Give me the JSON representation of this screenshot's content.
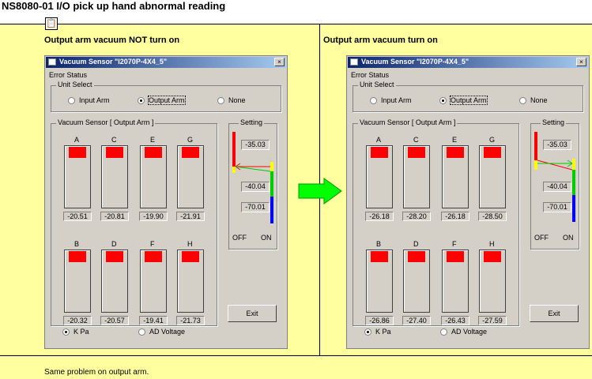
{
  "page": {
    "title": "NS8080-01 I/O pick up hand abnormal reading",
    "note": "Same problem on output arm.",
    "left_caption": "Output arm vacuum NOT turn on",
    "right_caption": "Output arm vacuum turn on"
  },
  "windows": [
    {
      "title": "Vacuum Sensor \"I2070P-4X4_5\"",
      "close": "×",
      "error_status": "Error Status",
      "unit_select": "Unit Select",
      "radios": [
        "Input Arm",
        "Output Arm",
        "None"
      ],
      "selected_unit": "Output Arm",
      "sensor_group": "Vacuum Sensor [ Output Arm ]",
      "sensors": [
        {
          "name": "A",
          "value": "-20.51"
        },
        {
          "name": "C",
          "value": "-20.81"
        },
        {
          "name": "E",
          "value": "-19.90"
        },
        {
          "name": "G",
          "value": "-21.91"
        },
        {
          "name": "B",
          "value": "-20.32"
        },
        {
          "name": "D",
          "value": "-20.57"
        },
        {
          "name": "F",
          "value": "-19.41"
        },
        {
          "name": "H",
          "value": "-21.73"
        }
      ],
      "setting": {
        "label": "Setting",
        "values": [
          "-35.03",
          "-40.04",
          "-70.01"
        ],
        "off": "OFF",
        "on": "ON"
      },
      "exit": "Exit",
      "units": [
        "K Pa",
        "AD Voltage"
      ],
      "selected_units": "K Pa",
      "colors": {
        "red": "#ff0000",
        "yellow": "#ffff00",
        "green": "#00cc00",
        "blue": "#0000ff"
      }
    },
    {
      "title": "Vacuum Sensor \"I2070P-4X4_5\"",
      "close": "×",
      "error_status": "Error Status",
      "unit_select": "Unit Select",
      "radios": [
        "Input Arm",
        "Output Arm",
        "None"
      ],
      "selected_unit": "Output Arm",
      "sensor_group": "Vacuum Sensor [ Output Arm ]",
      "sensors": [
        {
          "name": "A",
          "value": "-26.18"
        },
        {
          "name": "C",
          "value": "-28.20"
        },
        {
          "name": "E",
          "value": "-26.18"
        },
        {
          "name": "G",
          "value": "-28.50"
        },
        {
          "name": "B",
          "value": "-26.86"
        },
        {
          "name": "D",
          "value": "-27.40"
        },
        {
          "name": "F",
          "value": "-26.43"
        },
        {
          "name": "H",
          "value": "-27.59"
        }
      ],
      "setting": {
        "label": "Setting",
        "values": [
          "-35.03",
          "-40.04",
          "-70.01"
        ],
        "off": "OFF",
        "on": "ON"
      },
      "exit": "Exit",
      "units": [
        "K Pa",
        "AD Voltage"
      ],
      "selected_units": "K Pa",
      "colors": {
        "red": "#ff0000",
        "yellow": "#ffff00",
        "green": "#00cc00",
        "blue": "#0000ff"
      }
    }
  ],
  "arrow_color": "#00ff00"
}
